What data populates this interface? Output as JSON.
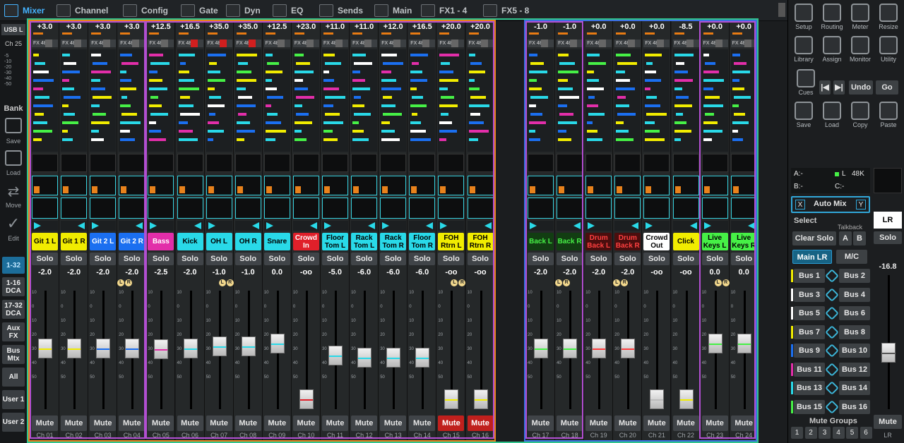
{
  "tabs": [
    "Mixer",
    "Channel",
    "Config",
    "Gate",
    "Dyn",
    "EQ",
    "Sends",
    "Main",
    "FX1 - 4",
    "FX5 - 8"
  ],
  "left": {
    "usb": "USB L",
    "ch": "Ch 25",
    "scale": [
      "-5",
      "-10",
      "-20",
      "-30",
      "-40",
      "-50"
    ],
    "bank": "Bank",
    "save": "Save",
    "load": "Load",
    "move": "Move",
    "edit": "Edit",
    "layers": [
      "1-32",
      "1-16 DCA",
      "17-32 DCA",
      "Aux FX",
      "Bus Mtx",
      "All",
      "User 1",
      "User 2"
    ]
  },
  "fader_scale": [
    "10",
    "0",
    "10",
    "20",
    "30",
    "40",
    "50"
  ],
  "solo": "Solo",
  "mute": "Mute",
  "channels": [
    {
      "gain": "+3.0",
      "name": "Git 1 L",
      "color": "#f1ec00",
      "text": "#000",
      "db": "-2.0",
      "lr": "",
      "ch": "Ch 01",
      "pos": 0.45,
      "c": "#f1ec00",
      "mute": false,
      "fx": false
    },
    {
      "gain": "+3.0",
      "name": "Git 1 R",
      "color": "#f1ec00",
      "text": "#000",
      "db": "-2.0",
      "lr": "",
      "ch": "Ch 02",
      "pos": 0.45,
      "c": "#f1ec00",
      "mute": false,
      "fx": false
    },
    {
      "gain": "+3.0",
      "name": "Git 2 L",
      "color": "#1b6ff0",
      "text": "#fff",
      "db": "-2.0",
      "lr": "",
      "ch": "Ch 03",
      "pos": 0.45,
      "c": "#1b6ff0",
      "mute": false,
      "fx": false
    },
    {
      "gain": "+3.0",
      "name": "Git 2 R",
      "color": "#1b6ff0",
      "text": "#fff",
      "db": "-2.0",
      "lr": "LR",
      "ch": "Ch 04",
      "pos": 0.45,
      "c": "#1b6ff0",
      "mute": false,
      "fx": false
    },
    {
      "gain": "+12.5",
      "name": "Bass",
      "color": "#e22ea9",
      "text": "#fff",
      "db": "-2.5",
      "lr": "",
      "ch": "Ch 05",
      "pos": 0.46,
      "c": "#e22ea9",
      "mute": false,
      "fx": false
    },
    {
      "gain": "+16.5",
      "name": "Kick",
      "color": "#29d9e8",
      "text": "#000",
      "db": "-2.0",
      "lr": "",
      "ch": "Ch 06",
      "pos": 0.45,
      "c": "#29d9e8",
      "mute": false,
      "fx": true
    },
    {
      "gain": "+35.0",
      "name": "OH L",
      "color": "#29d9e8",
      "text": "#000",
      "db": "-1.0",
      "lr": "LR",
      "ch": "Ch 07",
      "pos": 0.43,
      "c": "#29d9e8",
      "mute": false,
      "fx": true
    },
    {
      "gain": "+35.0",
      "name": "OH R",
      "color": "#29d9e8",
      "text": "#000",
      "db": "-1.0",
      "lr": "",
      "ch": "Ch 08",
      "pos": 0.43,
      "c": "#29d9e8",
      "mute": false,
      "fx": true
    },
    {
      "gain": "+12.5",
      "name": "Snare",
      "color": "#29d9e8",
      "text": "#000",
      "db": "0.0",
      "lr": "",
      "ch": "Ch 09",
      "pos": 0.41,
      "c": "#29d9e8",
      "mute": false,
      "fx": false
    },
    {
      "gain": "+23.0",
      "name": "Crowd In",
      "color": "#e0202a",
      "text": "#fff",
      "db": "-oo",
      "lr": "",
      "ch": "Ch 10",
      "pos": 0.93,
      "c": "#e0202a",
      "mute": false,
      "fx": false
    },
    {
      "gain": "+11.0",
      "name": "Floor Tom L",
      "color": "#29d9e8",
      "text": "#000",
      "db": "-5.0",
      "lr": "",
      "ch": "Ch 11",
      "pos": 0.52,
      "c": "#29d9e8",
      "mute": false,
      "fx": false
    },
    {
      "gain": "+11.0",
      "name": "Rack Tom L",
      "color": "#29d9e8",
      "text": "#000",
      "db": "-6.0",
      "lr": "",
      "ch": "Ch 12",
      "pos": 0.54,
      "c": "#29d9e8",
      "mute": false,
      "fx": false
    },
    {
      "gain": "+12.0",
      "name": "Rack Tom R",
      "color": "#29d9e8",
      "text": "#000",
      "db": "-6.0",
      "lr": "",
      "ch": "Ch 13",
      "pos": 0.54,
      "c": "#29d9e8",
      "mute": false,
      "fx": false
    },
    {
      "gain": "+16.5",
      "name": "Floor Tom R",
      "color": "#29d9e8",
      "text": "#000",
      "db": "-6.0",
      "lr": "",
      "ch": "Ch 14",
      "pos": 0.54,
      "c": "#29d9e8",
      "mute": false,
      "fx": false
    },
    {
      "gain": "+20.0",
      "name": "FOH Rtrn L",
      "color": "#f1ec00",
      "text": "#000",
      "db": "-oo",
      "lr": "LR",
      "ch": "Ch 15",
      "pos": 0.93,
      "c": "#f1ec00",
      "mute": true,
      "fx": false
    },
    {
      "gain": "+20.0",
      "name": "FOH Rtrn R",
      "color": "#f1ec00",
      "text": "#000",
      "db": "-oo",
      "lr": "",
      "ch": "Ch 16",
      "pos": 0.93,
      "c": "#f1ec00",
      "mute": true,
      "fx": false
    },
    {
      "gain": "-1.0",
      "name": "Back L",
      "color": "#123d12",
      "text": "#46f046",
      "db": "-2.0",
      "lr": "",
      "ch": "Ch 17",
      "pos": 0.45,
      "c": "#46f046",
      "mute": false,
      "fx": false
    },
    {
      "gain": "-1.0",
      "name": "Back R",
      "color": "#123d12",
      "text": "#46f046",
      "db": "-2.0",
      "lr": "LR",
      "ch": "Ch 18",
      "pos": 0.45,
      "c": "#46f046",
      "mute": false,
      "fx": false
    },
    {
      "gain": "+0.0",
      "name": "Drum Back L",
      "color": "#4a0e0e",
      "text": "#ff4040",
      "db": "-2.0",
      "lr": "",
      "ch": "Ch 19",
      "pos": 0.45,
      "c": "#ff4040",
      "mute": false,
      "fx": false
    },
    {
      "gain": "+0.0",
      "name": "Drum Back R",
      "color": "#4a0e0e",
      "text": "#ff4040",
      "db": "-2.0",
      "lr": "LR",
      "ch": "Ch 20",
      "pos": 0.45,
      "c": "#ff4040",
      "mute": false,
      "fx": false
    },
    {
      "gain": "+0.0",
      "name": "Crowd Out",
      "color": "#ffffff",
      "text": "#000",
      "db": "-oo",
      "lr": "",
      "ch": "Ch 21",
      "pos": 0.93,
      "c": "#bbbbbb",
      "mute": false,
      "fx": false
    },
    {
      "gain": "-8.5",
      "name": "Click",
      "color": "#f1ec00",
      "text": "#000",
      "db": "-oo",
      "lr": "",
      "ch": "Ch 22",
      "pos": 0.93,
      "c": "#f1ec00",
      "mute": false,
      "fx": false
    },
    {
      "gain": "+0.0",
      "name": "Live Keys L",
      "color": "#46f046",
      "text": "#000",
      "db": "0.0",
      "lr": "LR",
      "ch": "Ch 23",
      "pos": 0.41,
      "c": "#46f046",
      "mute": false,
      "fx": false
    },
    {
      "gain": "+0.0",
      "name": "Live Keys R",
      "color": "#46f046",
      "text": "#000",
      "db": "0.0",
      "lr": "",
      "ch": "Ch 24",
      "pos": 0.41,
      "c": "#46f046",
      "mute": false,
      "fx": false
    }
  ],
  "right": {
    "icons": [
      [
        "Setup",
        "Routing",
        "Meter",
        "Resize"
      ],
      [
        "Library",
        "Assign",
        "Monitor",
        "Utility"
      ]
    ],
    "cues": "Cues",
    "undo": "Undo",
    "go": "Go",
    "files": [
      "Save",
      "Load",
      "Copy",
      "Paste"
    ],
    "status": {
      "a": "A:-",
      "l": "L",
      "rate": "48K",
      "b": "B:-",
      "c": "C:-"
    },
    "automix": {
      "x": "X",
      "label": "Auto Mix",
      "y": "Y"
    },
    "select": "Select",
    "talkback": "Talkback",
    "clear_solo": "Clear Solo",
    "ta": "A",
    "tb": "B",
    "main_lr": "Main LR",
    "mc": "M/C",
    "buses": [
      "Bus 1",
      "Bus 2",
      "Bus 3",
      "Bus 4",
      "Bus 5",
      "Bus 6",
      "Bus 7",
      "Bus 8",
      "Bus 9",
      "Bus 10",
      "Bus 11",
      "Bus 12",
      "Bus 13",
      "Bus 14",
      "Bus 15",
      "Bus 16"
    ],
    "bus_colors": [
      "#f1ec00",
      "#3d4144",
      "#ffffff",
      "#3d4144",
      "#ffffff",
      "#3d4144",
      "#f1ec00",
      "#3d4144",
      "#1b6ff0",
      "#3d4144",
      "#e22ea9",
      "#3d4144",
      "#29d9e8",
      "#3d4144",
      "#46f046",
      "#3d4144"
    ],
    "mute_groups": "Mute Groups",
    "mg": [
      "1",
      "2",
      "3",
      "4",
      "5",
      "6"
    ],
    "lr": {
      "name": "LR",
      "solo": "Solo",
      "db": "-16.8",
      "mute": "Mute",
      "label": "LR"
    }
  },
  "colors": {
    "accent": "#45b3ff",
    "green_group": "#31c48d",
    "orange_group": "#e8821c",
    "purple_group": "#b24fd1",
    "blue_group": "#3c6fe0"
  }
}
